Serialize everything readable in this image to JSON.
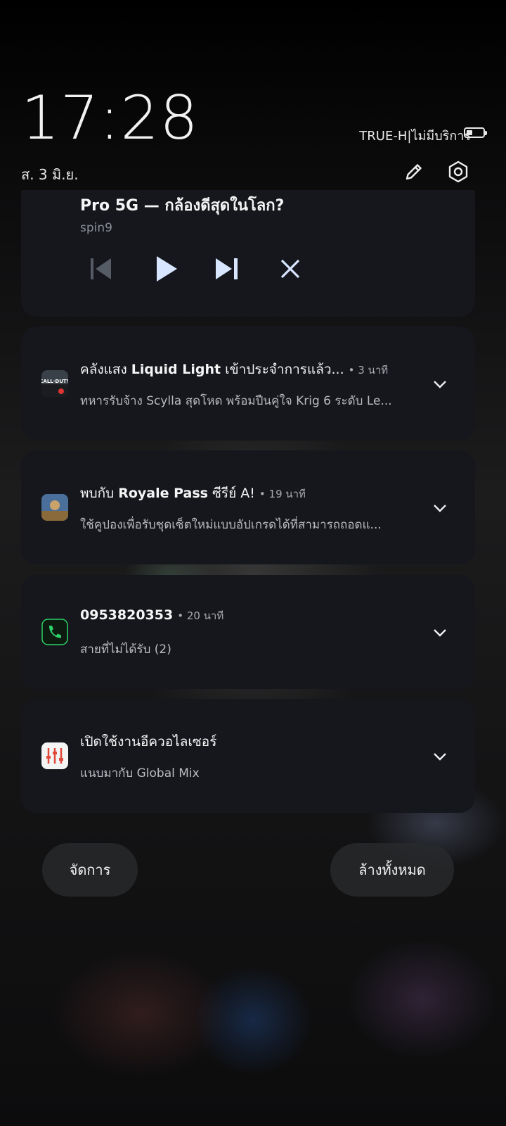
{
  "status_bar": {
    "time": "17:28",
    "date": "ส. 3 มิ.ย.",
    "carrier": "TRUE-H|ไม่มีบริการ",
    "battery_level": 0.35
  },
  "media": {
    "title": "Pro 5G — กล้องดีสุดในโลก?",
    "source": "spin9"
  },
  "notifications": [
    {
      "app_icon": "call-of-duty-icon",
      "title_pre": "คลังแสง ",
      "title_bold": "Liquid Light",
      "title_post": " เข้าประจำการแล้ว...",
      "time": "• 3 นาที",
      "text": "ทหารรับจ้าง Scylla สุดโหด พร้อมปืนคู่ใจ Krig 6 ระดับ Le..."
    },
    {
      "app_icon": "pubg-icon",
      "title_pre": "พบกับ ",
      "title_bold": "Royale Pass",
      "title_post": " ซีรีย์ A!",
      "time": "• 19 นาที",
      "text": "ใช้คูปองเพื่อรับชุดเซ็ตใหม่แบบอัปเกรดได้ที่สามารถถอดแ..."
    },
    {
      "app_icon": "phone-call-icon",
      "title_pre": "",
      "title_bold": "0953820353",
      "title_post": "",
      "time": "• 20 นาที",
      "text": "สายที่ไม่ได้รับ (2)"
    },
    {
      "app_icon": "equalizer-icon",
      "title_pre": "เปิดใช้งานอีควอไลเซอร์",
      "title_bold": "",
      "title_post": "",
      "time": "",
      "text": "แนบมากับ Global Mix"
    }
  ],
  "buttons": {
    "manage": "จัดการ",
    "clear_all": "ล้างทั้งหมด"
  }
}
